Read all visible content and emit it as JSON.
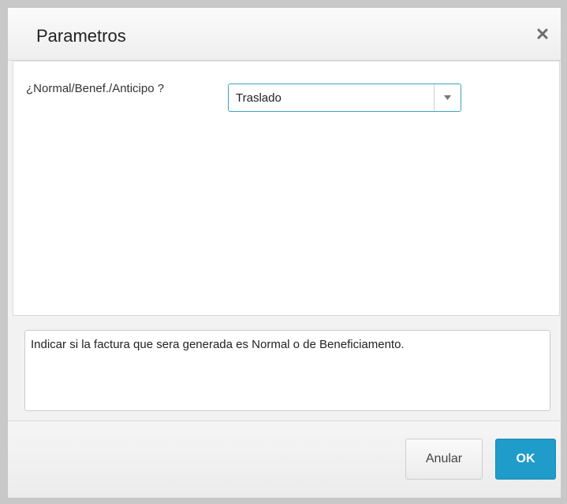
{
  "dialog": {
    "title": "Parametros",
    "close_icon": "close-icon"
  },
  "form": {
    "field_label": "¿Normal/Benef./Anticipo ?",
    "select_value": "Traslado",
    "select_arrow_icon": "chevron-down-icon"
  },
  "help": {
    "text": "Indicar si la factura que sera generada es Normal o de Beneficiamento."
  },
  "footer": {
    "cancel_label": "Anular",
    "ok_label": "OK"
  },
  "colors": {
    "accent": "#1f9cc9",
    "select_border": "#3da3c0"
  }
}
